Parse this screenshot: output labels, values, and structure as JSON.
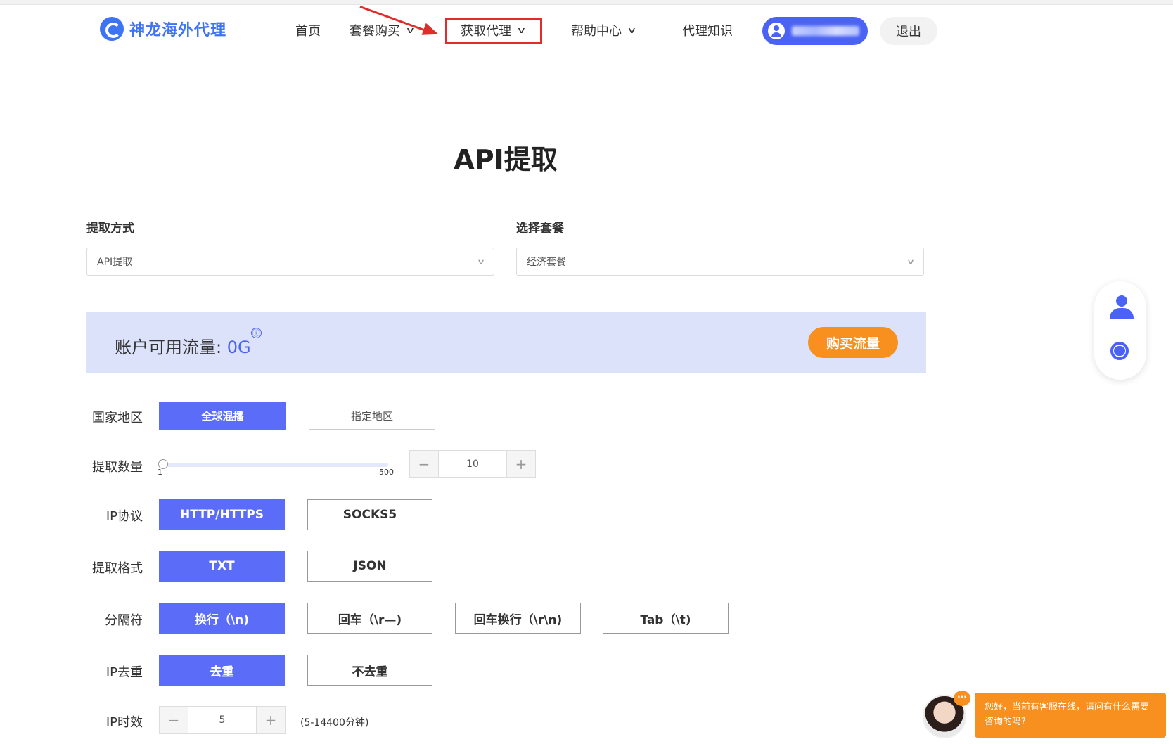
{
  "header": {
    "logo_text": "神龙海外代理",
    "nav": [
      {
        "label": "首页"
      },
      {
        "label": "套餐购买"
      },
      {
        "label": "获取代理"
      },
      {
        "label": "帮助中心"
      },
      {
        "label": "代理知识"
      }
    ],
    "logout_label": "退出"
  },
  "page": {
    "title": "API提取"
  },
  "form": {
    "method_label": "提取方式",
    "method_value": "API提取",
    "package_label": "选择套餐",
    "package_value": "经济套餐"
  },
  "flow": {
    "label": "账户可用流量:",
    "value": "0G",
    "info_icon": "ⓘ",
    "buy_label": "购买流量"
  },
  "rows": {
    "region": {
      "label": "国家地区",
      "options": [
        "全球混播",
        "指定地区"
      ]
    },
    "quantity": {
      "label": "提取数量",
      "min": "1",
      "max": "500",
      "value": "10",
      "minus": "−",
      "plus": "+"
    },
    "protocol": {
      "label": "IP协议",
      "options": [
        "HTTP/HTTPS",
        "SOCKS5"
      ]
    },
    "format": {
      "label": "提取格式",
      "options": [
        "TXT",
        "JSON"
      ]
    },
    "separator": {
      "label": "分隔符",
      "options": [
        "换行（\\n)",
        "回车（\\r—)",
        "回车换行（\\r\\n)",
        "Tab（\\t)"
      ]
    },
    "dedupe": {
      "label": "IP去重",
      "options": [
        "去重",
        "不去重"
      ]
    },
    "duration": {
      "label": "IP时效",
      "value": "5",
      "minus": "−",
      "plus": "+",
      "hint": "(5-14400分钟)"
    }
  },
  "chat": {
    "dots": "···",
    "message": "您好，当前有客服在线，请问有什么需要咨询的吗?"
  },
  "colors": {
    "primary": "#5b6df8",
    "accent": "#f7901e",
    "annotation": "#e32b2b"
  }
}
